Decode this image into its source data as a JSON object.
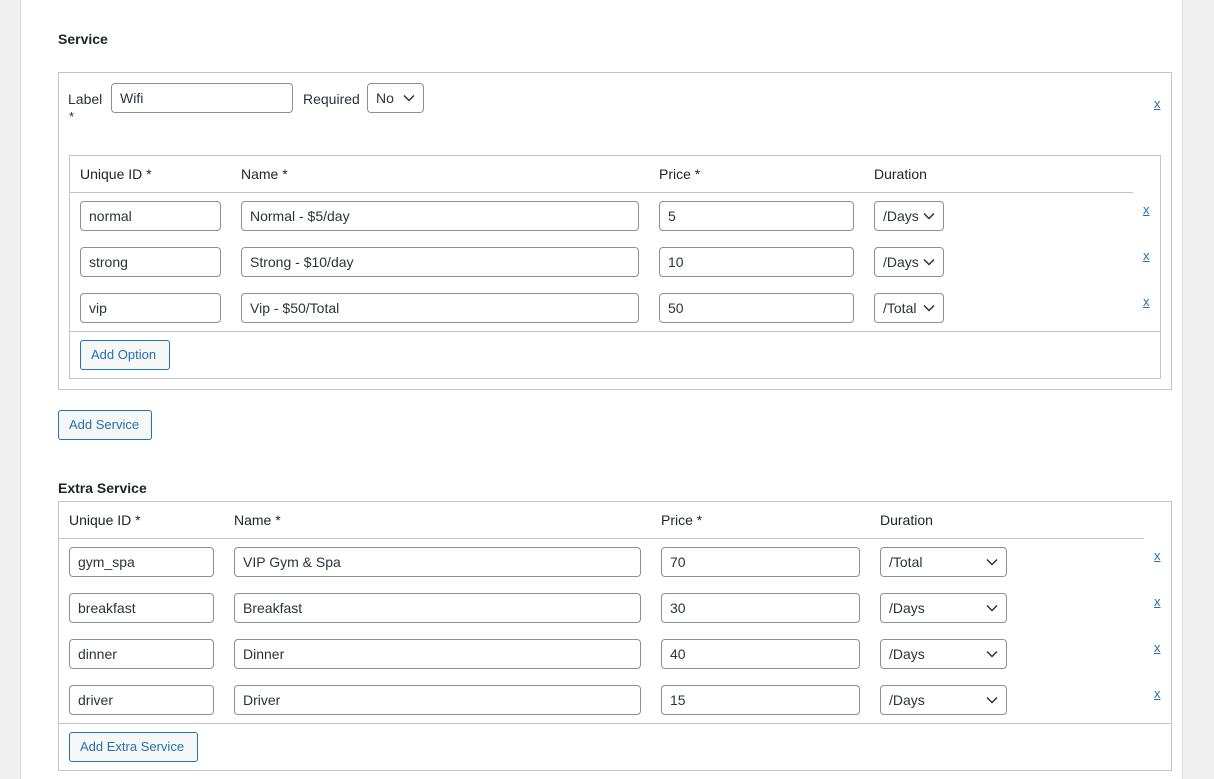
{
  "service": {
    "title": "Service",
    "label_label": "Label",
    "label_star": "*",
    "label_value": "Wifi",
    "required_label": "Required",
    "required_value": "No",
    "remove_label": "x",
    "headers": {
      "id": "Unique ID *",
      "name": "Name *",
      "price": "Price *",
      "duration": "Duration"
    },
    "options": [
      {
        "id": "normal",
        "name": "Normal - $5/day",
        "price": "5",
        "duration": "/Days",
        "remove": "x"
      },
      {
        "id": "strong",
        "name": "Strong - $10/day",
        "price": "10",
        "duration": "/Days",
        "remove": "x"
      },
      {
        "id": "vip",
        "name": "Vip - $50/Total",
        "price": "50",
        "duration": "/Total",
        "remove": "x"
      }
    ],
    "add_option_label": "Add Option",
    "add_service_label": "Add Service"
  },
  "extra": {
    "title": "Extra Service",
    "headers": {
      "id": "Unique ID *",
      "name": "Name *",
      "price": "Price *",
      "duration": "Duration"
    },
    "rows": [
      {
        "id": "gym_spa",
        "name": "VIP Gym & Spa",
        "price": "70",
        "duration": "/Total",
        "remove": "x"
      },
      {
        "id": "breakfast",
        "name": "Breakfast",
        "price": "30",
        "duration": "/Days",
        "remove": "x"
      },
      {
        "id": "dinner",
        "name": "Dinner",
        "price": "40",
        "duration": "/Days",
        "remove": "x"
      },
      {
        "id": "driver",
        "name": "Driver",
        "price": "15",
        "duration": "/Days",
        "remove": "x"
      }
    ],
    "add_label": "Add Extra Service"
  }
}
